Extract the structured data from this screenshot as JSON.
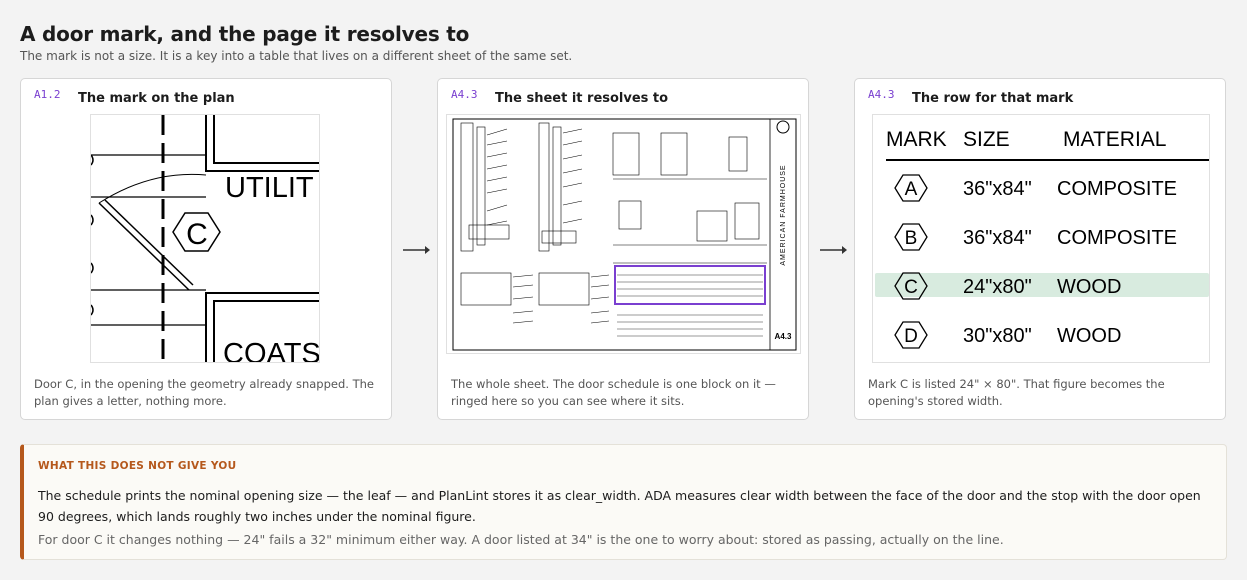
{
  "header": {
    "title": "A door mark, and the page it resolves to",
    "subtitle": "The mark is not a size. It is a key into a table that lives on a different sheet of the same set."
  },
  "cards": [
    {
      "sheet_code": "A1.2",
      "title": "The mark on the plan",
      "caption": "Door C, in the opening the geometry already snapped. The plan gives a letter, nothing more.",
      "plan_labels": {
        "room_top": "UTILIT",
        "room_bottom": "COATS",
        "door_mark": "C"
      }
    },
    {
      "sheet_code": "A4.3",
      "title": "The sheet it resolves to",
      "caption": "The whole sheet. The door schedule is one block on it — ringed here so you can see where it sits.",
      "sheet_number": "A4.3",
      "sheet_brand": "AMERICAN FARMHOUSE"
    },
    {
      "sheet_code": "A4.3",
      "title": "The row for that mark",
      "caption": "Mark C is listed 24\" × 80\". That figure becomes the opening's stored width.",
      "schedule": {
        "headers": [
          "MARK",
          "SIZE",
          "MATERIAL"
        ],
        "rows": [
          {
            "mark": "A",
            "size": "36\"x84\"",
            "material": "COMPOSITE"
          },
          {
            "mark": "B",
            "size": "36\"x84\"",
            "material": "COMPOSITE"
          },
          {
            "mark": "C",
            "size": "24\"x80\"",
            "material": "WOOD"
          },
          {
            "mark": "D",
            "size": "30\"x80\"",
            "material": "WOOD"
          }
        ],
        "highlight_color": "#d8ebdf"
      }
    }
  ],
  "callout": {
    "label": "WHAT THIS DOES NOT GIVE YOU",
    "body": "The schedule prints the nominal opening size — the leaf — and PlanLint stores it as clear_width. ADA measures clear width between the face of the door and the stop with the door open 90 degrees, which lands roughly two inches under the nominal figure.",
    "note": "For door C it changes nothing — 24\" fails a 32\" minimum either way. A door listed at 34\" is the one to worry about: stored as passing, actually on the line.",
    "accent_color": "#b5581c"
  },
  "colors": {
    "sheet_code": "#7a3fd0",
    "ring": "#7a3fd0"
  }
}
